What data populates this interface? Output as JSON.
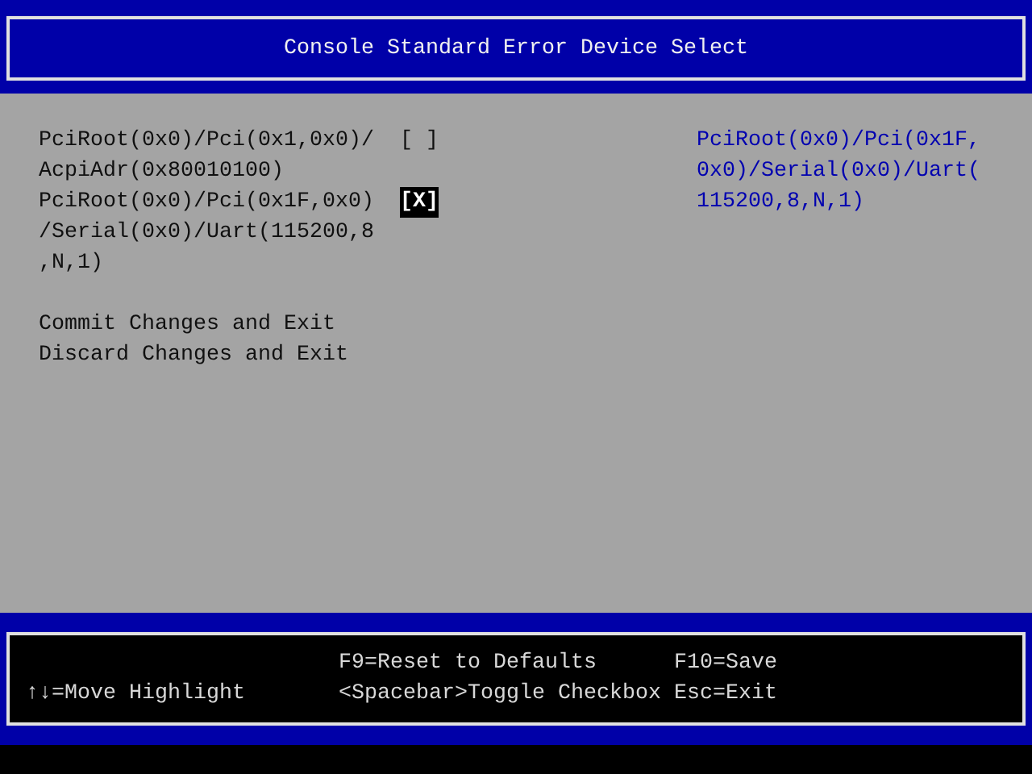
{
  "title": "Console Standard Error Device Select",
  "check_mark": "X",
  "options": [
    {
      "lines": [
        "PciRoot(0x0)/Pci(0x1,0x0)/",
        "AcpiAdr(0x80010100)"
      ],
      "checkbox_open": "[",
      "checkbox_close": "]",
      "checked": false,
      "selected": false
    },
    {
      "lines": [
        "PciRoot(0x0)/Pci(0x1F,0x0)",
        "/Serial(0x0)/Uart(115200,8",
        ",N,1)"
      ],
      "checkbox_open": "[",
      "checkbox_close": "]",
      "checked": true,
      "selected": true
    }
  ],
  "actions": [
    "Commit Changes and Exit",
    "Discard Changes and Exit"
  ],
  "help_lines": [
    "PciRoot(0x0)/Pci(0x1F,",
    "0x0)/Serial(0x0)/Uart(",
    "115200,8,N,1)"
  ],
  "footer_columns": [
    [
      "↑↓=Move Highlight"
    ],
    [
      "F9=Reset to Defaults",
      "<Spacebar>Toggle Checkbox"
    ],
    [
      "F10=Save",
      "Esc=Exit"
    ]
  ]
}
